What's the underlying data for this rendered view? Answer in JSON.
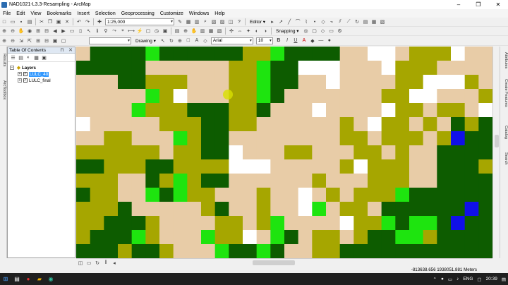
{
  "window": {
    "title": "NAD1021-L3.3-Resampling - ArcMap",
    "min": "–",
    "max": "❐",
    "close": "✕"
  },
  "menu": [
    "File",
    "Edit",
    "View",
    "Bookmarks",
    "Insert",
    "Selection",
    "Geoprocessing",
    "Customize",
    "Windows",
    "Help"
  ],
  "toolbar": {
    "scale": "1:25,000",
    "editor": "Editor ▾",
    "snapping": "Snapping ▾",
    "drawing": "Drawing ▾",
    "font": "Arial",
    "font_size": "10",
    "bold": "B",
    "italic": "I",
    "underline": "U",
    "text_color": "A"
  },
  "toc": {
    "title": "Table Of Contents",
    "pin": "⊓",
    "close": "✕",
    "root": "Layers",
    "layers": [
      {
        "name": "LULC_40",
        "checked": "✓",
        "selected": true
      },
      {
        "name": "LULC_final",
        "checked": "✓",
        "selected": false
      }
    ]
  },
  "left_tabs": [
    "Results",
    "ArcToolbox"
  ],
  "right_tabs": [
    "Attributes",
    "Create Features",
    "Catalog",
    "Search"
  ],
  "status": {
    "coords": "-813638.656  1938051.881 Meters"
  },
  "taskbar": {
    "lang": "ENG",
    "time": "20:39"
  },
  "colors": {
    "dark_green": "#0d5c00",
    "bright_green": "#1ee40f",
    "olive": "#a6a600",
    "tan": "#e8cca7",
    "blue": "#1010e8",
    "white": "#ffffff"
  },
  "map_grid": {
    "cols": 30,
    "rows": 15,
    "rows_data": [
      "TDDDDGDDDDDDOOGDDDDTTWWTOOOWTT",
      "DDDDDTTTTTTOOGDDWWWTTTWOOOTTTT",
      "TTTDDOOOTTTOOGDDTTWTTTTOOWWWOT",
      "TTTTTGOWTTTOOGDTTTTTTTOOWWTTTO",
      "TTTTGOOODDDOODTTTWTTTTWOOTOOTW",
      "WTTTTTOOODDOOTTTTTTOTWOOTOTDOD",
      "TTOOTTTGODDTTTTTTTTOOTOOOTOBDD",
      "OOOOOOTOODDWTTTOOTTTOOTOTTDDDD",
      "DDOOODDOOOOWWWTTTTTOWOOOTTDDDO",
      "OOOTTDOGODDTTTTTTOTTTOOOTTDDDD",
      "DOOTTGDGOOTTTOTTWTOTOOOGDDDDDD",
      "OOODTTTTTODTTOTTWGTOOTDDDDDDBD",
      "OODDDOTTTTOOTOGTTTTWOOGDGGDBDD",
      "ODDDGOTTTGOOWTGDTOOTODDGGODDDD",
      "DDDODDOTTTGDDGDTTOODDDDDDDDDDD"
    ]
  }
}
